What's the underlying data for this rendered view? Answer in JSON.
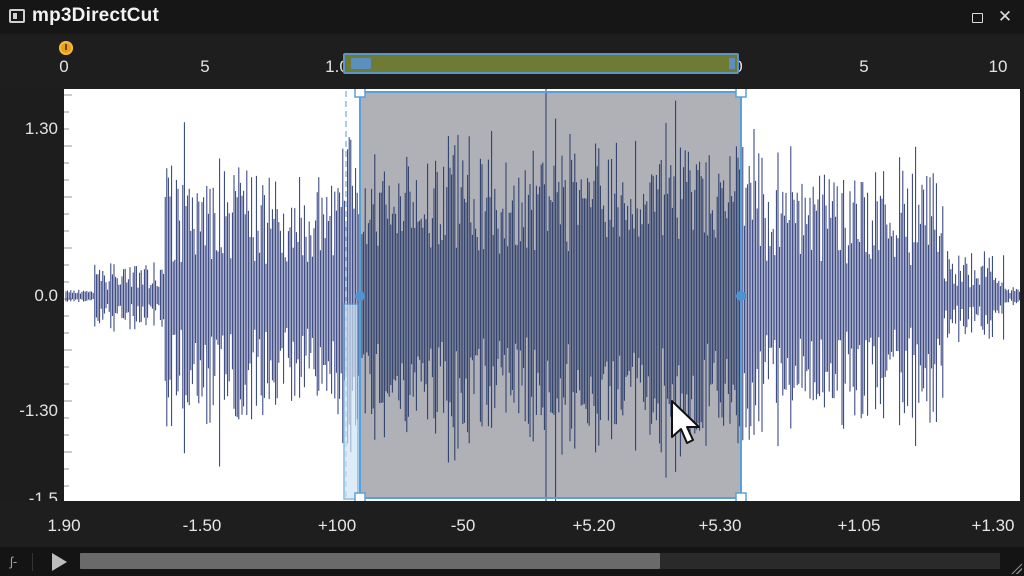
{
  "window": {
    "title": "mp3DirectCut",
    "restore_icon": "restore-icon",
    "close_icon": "close-icon",
    "close_label": "✕"
  },
  "top_ruler": {
    "ticks": [
      {
        "label": "0",
        "value": 0
      },
      {
        "label": "5",
        "value": 5
      },
      {
        "label": "1.0",
        "value": 10
      },
      {
        "label": "0",
        "value": 30
      },
      {
        "label": "5",
        "value": 35
      },
      {
        "label": "10",
        "value": 40
      }
    ],
    "marker_icon": "marker-icon"
  },
  "y_axis": {
    "labels": [
      {
        "label": "1.30",
        "value": 1.3
      },
      {
        "label": "0.0",
        "value": 0.0
      },
      {
        "label": "-1.30",
        "value": -1.3
      },
      {
        "label": "-1.5",
        "value": -1.5
      }
    ]
  },
  "x_axis": {
    "labels": [
      "1.90",
      "-1.50",
      "+100",
      "-50",
      "+5.20",
      "+5.30",
      "+1.05",
      "+1.30"
    ]
  },
  "selection": {
    "start_fraction": 0.31,
    "end_fraction": 0.708,
    "fill_color": "#a9a9b1",
    "border_color": "#5aa0d8"
  },
  "waveform": {
    "color": "#2b3a7a"
  },
  "transport": {
    "fx_label": "ʃ-",
    "play_icon": "play-icon",
    "scroll_position_fraction": 0.63
  },
  "cursor_icon": "mouse-pointer-icon"
}
